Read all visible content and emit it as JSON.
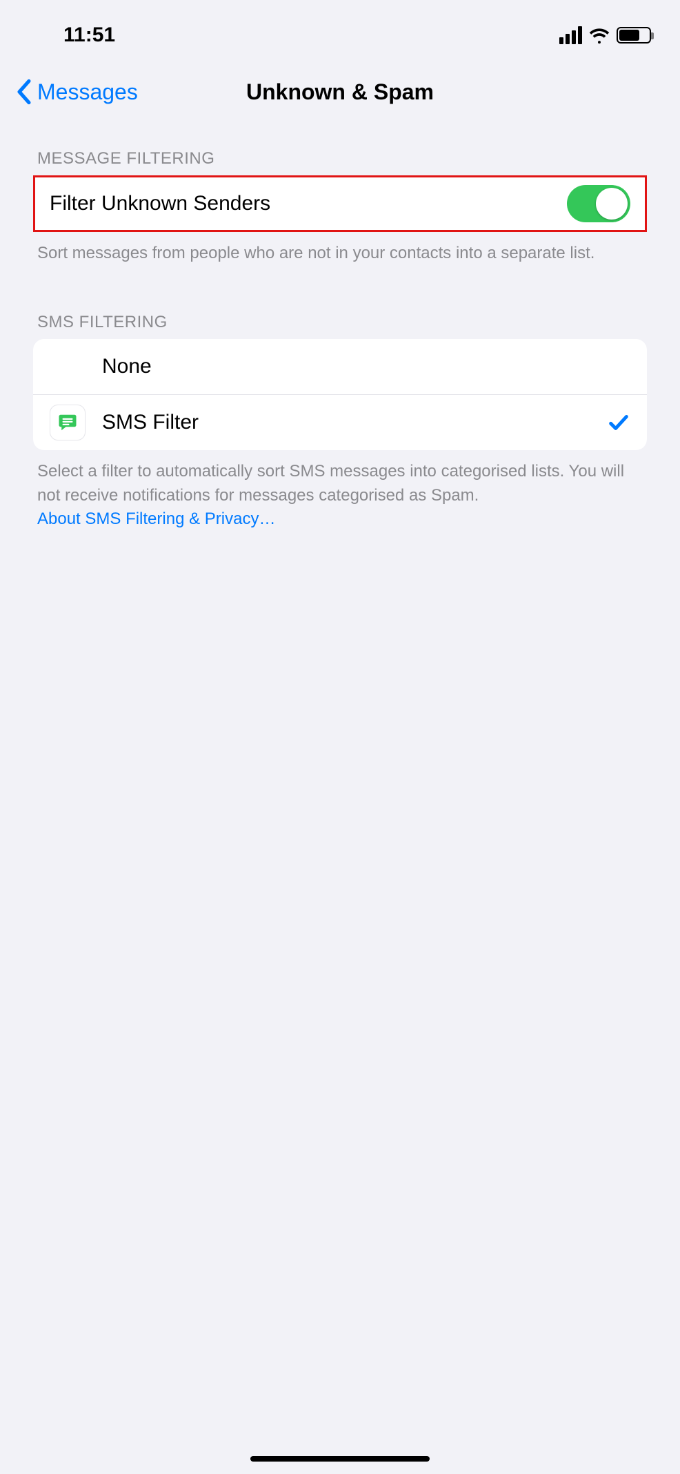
{
  "statusBar": {
    "time": "11:51"
  },
  "nav": {
    "backLabel": "Messages",
    "title": "Unknown & Spam"
  },
  "sections": {
    "messageFiltering": {
      "header": "MESSAGE FILTERING",
      "rowLabel": "Filter Unknown Senders",
      "toggleOn": true,
      "footer": "Sort messages from people who are not in your contacts into a separate list."
    },
    "smsFiltering": {
      "header": "SMS FILTERING",
      "noneLabel": "None",
      "filterLabel": "SMS Filter",
      "footerText": "Select a filter to automatically sort SMS messages into categorised lists. You will not receive notifications for messages categorised as Spam.",
      "footerLink": "About SMS Filtering & Privacy…"
    }
  }
}
